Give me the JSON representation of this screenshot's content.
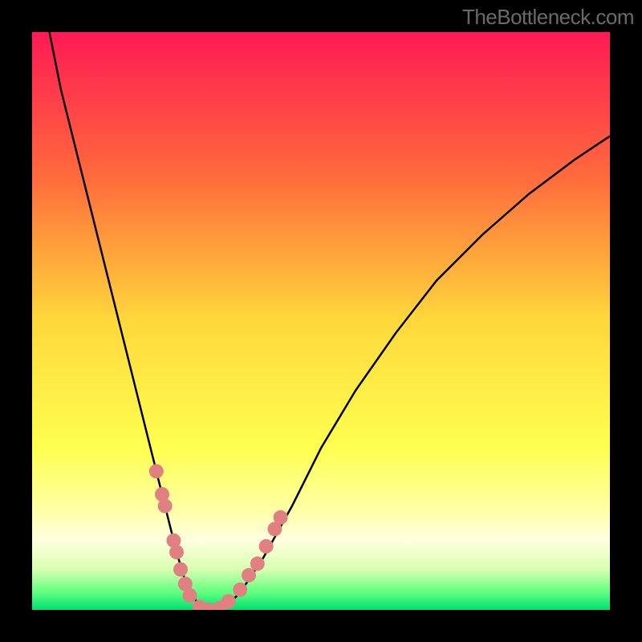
{
  "watermark": "TheBottleneck.com",
  "chart_data": {
    "type": "line",
    "title": "",
    "xlabel": "",
    "ylabel": "",
    "xlim": [
      0,
      100
    ],
    "ylim": [
      0,
      100
    ],
    "background_gradient": {
      "stops": [
        {
          "offset": 0,
          "color": "#ff1a55"
        },
        {
          "offset": 0.25,
          "color": "#ff6a3c"
        },
        {
          "offset": 0.5,
          "color": "#ffd83c"
        },
        {
          "offset": 0.72,
          "color": "#ffff50"
        },
        {
          "offset": 0.82,
          "color": "#ffffa0"
        },
        {
          "offset": 0.88,
          "color": "#ffffe0"
        },
        {
          "offset": 0.93,
          "color": "#d8ffb0"
        },
        {
          "offset": 0.97,
          "color": "#60ff80"
        },
        {
          "offset": 1.0,
          "color": "#00e070"
        }
      ]
    },
    "series": [
      {
        "name": "bottleneck-curve",
        "x": [
          3,
          5,
          8,
          11,
          14,
          17,
          19,
          21,
          23,
          25,
          26.5,
          28,
          30,
          33,
          36,
          40,
          45,
          50,
          56,
          63,
          70,
          78,
          86,
          94,
          100
        ],
        "y": [
          100,
          90,
          78,
          66,
          54,
          42,
          34,
          26,
          18,
          10,
          5,
          2,
          0,
          0,
          3,
          9,
          18,
          28,
          38,
          48,
          57,
          65,
          72,
          78,
          82
        ]
      }
    ],
    "scatter_points": {
      "name": "highlight-dots",
      "x": [
        21.5,
        22.5,
        23.0,
        24.5,
        25.0,
        25.7,
        26.5,
        27.3,
        29.0,
        30.5,
        32.5,
        34.0,
        36.0,
        37.5,
        39.0,
        40.5,
        42.0,
        43.0
      ],
      "y": [
        24,
        20,
        18,
        12,
        10,
        7,
        4.5,
        2.5,
        0.5,
        0,
        0.3,
        1.5,
        3.5,
        6,
        8,
        11,
        14,
        16
      ],
      "color": "#e08080",
      "radius": 9
    }
  }
}
